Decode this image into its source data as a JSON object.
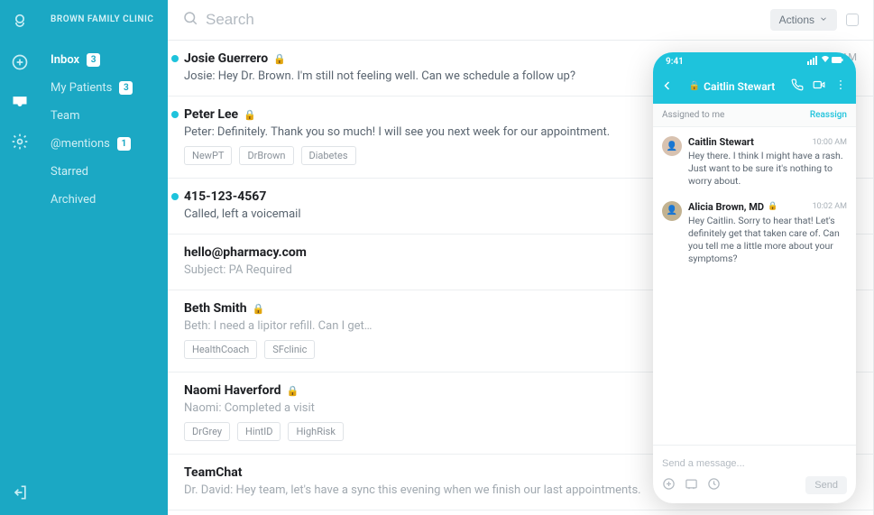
{
  "clinic_name": "BROWN FAMILY CLINIC",
  "sidebar": {
    "items": [
      {
        "label": "Inbox",
        "badge": "3"
      },
      {
        "label": "My Patients",
        "badge": "3"
      },
      {
        "label": "Team"
      },
      {
        "label": "@mentions",
        "badge": "1"
      },
      {
        "label": "Starred"
      },
      {
        "label": "Archived"
      }
    ]
  },
  "search_placeholder": "Search",
  "actions_label": "Actions",
  "threads": [
    {
      "name": "Josie Guerrero",
      "lock": true,
      "unread": true,
      "time": "10:45 AM",
      "preview": "Josie: Hey Dr. Brown. I'm still not feeling well. Can we schedule a follow up?"
    },
    {
      "name": "Peter Lee",
      "lock": true,
      "unread": true,
      "preview": "Peter: Definitely. Thank you so much! I will see you next week for our appointment.",
      "tags": [
        "NewPT",
        "DrBrown",
        "Diabetes"
      ]
    },
    {
      "name": "415-123-4567",
      "unread": true,
      "preview": "Called, left a voicemail"
    },
    {
      "name": "hello@pharmacy.com",
      "read": true,
      "preview": "Subject: PA Required"
    },
    {
      "name": "Beth Smith",
      "lock": true,
      "read": true,
      "preview": "Beth: I need a lipitor refill. Can I get…",
      "tags": [
        "HealthCoach",
        "SFclinic"
      ]
    },
    {
      "name": "Naomi Haverford",
      "lock": true,
      "read": true,
      "preview": "Naomi: Completed a visit",
      "tags": [
        "DrGrey",
        "HintID",
        "HighRisk"
      ]
    },
    {
      "name": "TeamChat",
      "read": true,
      "preview": "Dr. David: Hey team, let's have a sync this evening when we finish our last appointments."
    }
  ],
  "phone": {
    "time": "9:41",
    "contact": "Caitlin Stewart",
    "assigned_label": "Assigned to me",
    "reassign_label": "Reassign",
    "compose_placeholder": "Send a message...",
    "send_label": "Send",
    "messages": [
      {
        "sender": "Caitlin Stewart",
        "time": "10:00 AM",
        "text": "Hey there. I think I might have a rash. Just want to be sure it's nothing to worry about."
      },
      {
        "sender": "Alicia Brown, MD",
        "lock": true,
        "time": "10:02 AM",
        "text": "Hey Caitlin. Sorry to hear that! Let's definitely get that taken care of. Can you tell me a little more about your symptoms?"
      }
    ]
  }
}
